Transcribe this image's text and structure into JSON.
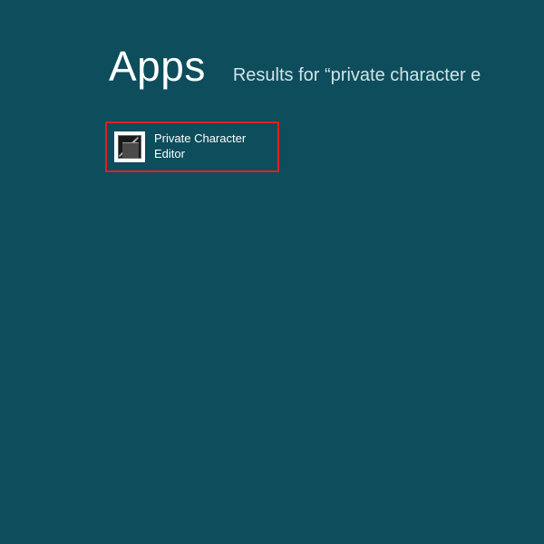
{
  "header": {
    "title": "Apps",
    "results_prefix": "Results for “private character e"
  },
  "results": {
    "items": [
      {
        "label": "Private Character Editor",
        "icon": "private-character-editor-icon"
      }
    ]
  }
}
